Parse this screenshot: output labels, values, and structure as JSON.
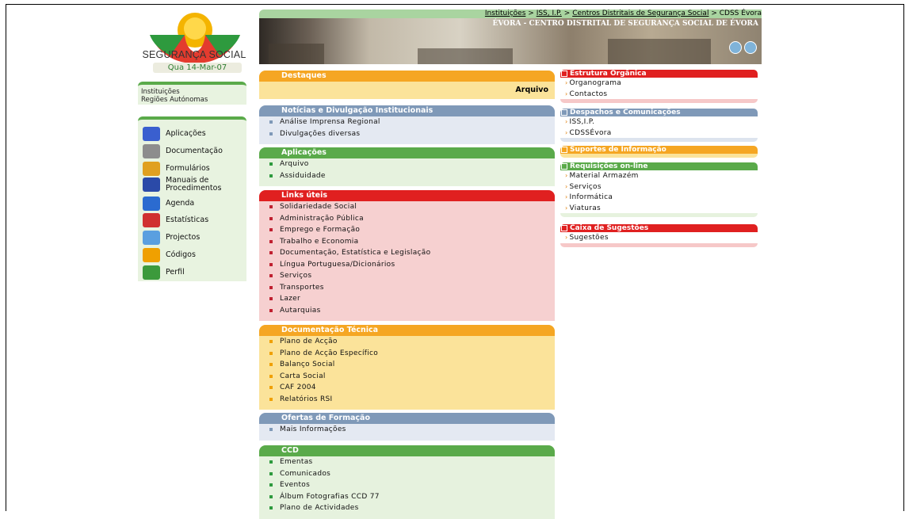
{
  "header": {
    "logo_text": "SEGURANÇA SOCIAL",
    "date": "Qua 14-Mar-07",
    "breadcrumb": [
      "Instituições",
      ">",
      "ISS, I.P.",
      ">",
      "Centros Distritais de Segurança Social",
      ">",
      "CDSS Évora"
    ],
    "banner_title": "ÉVORA - CENTRO DISTRITAL DE SEGURANÇA SOCIAL DE ÉVORA"
  },
  "sidebar": {
    "links": [
      "Instituições",
      "Regiões Autónomas"
    ],
    "apps": [
      {
        "label": "Aplicações",
        "icon": "applications-icon",
        "color": "#3a5fcf"
      },
      {
        "label": "Documentação",
        "icon": "documentation-icon",
        "color": "#8d8d8d"
      },
      {
        "label": "Formulários",
        "icon": "forms-icon",
        "color": "#e0a020"
      },
      {
        "label": "Manuais de\nProcedimentos",
        "icon": "manuals-icon",
        "color": "#2b4aa8"
      },
      {
        "label": "Agenda",
        "icon": "agenda-icon",
        "color": "#2b6bd0"
      },
      {
        "label": "Estatísticas",
        "icon": "statistics-icon",
        "color": "#d03030"
      },
      {
        "label": "Projectos",
        "icon": "projects-icon",
        "color": "#5a9fe0"
      },
      {
        "label": "Códigos",
        "icon": "codes-icon",
        "color": "#f0a000"
      },
      {
        "label": "Perfil",
        "icon": "profile-icon",
        "color": "#3c9a3c"
      }
    ]
  },
  "main": {
    "destaques": {
      "title": "Destaques",
      "link": "Arquivo"
    },
    "noticias": {
      "title": "Notícias e Divulgação Institucionais",
      "items": [
        "Análise Imprensa Regional",
        "Divulgações diversas"
      ]
    },
    "aplicacoes": {
      "title": "Aplicações",
      "items": [
        "Arquivo",
        "Assiduidade"
      ]
    },
    "links": {
      "title": "Links úteis",
      "items": [
        "Solidariedade Social",
        "Administração Pública",
        "Emprego e Formação",
        "Trabalho e Economia",
        "Documentação, Estatística e Legislação",
        "Língua Portuguesa/Dicionários",
        "Serviços",
        "Transportes",
        "Lazer",
        "Autarquias"
      ]
    },
    "doc_tecnica": {
      "title": "Documentação Técnica",
      "items": [
        "Plano de Acção",
        "Plano de Acção Específico",
        "Balanço Social",
        "Carta Social",
        "CAF 2004",
        "Relatórios RSI"
      ]
    },
    "formacao": {
      "title": "Ofertas de Formação",
      "items": [
        "Mais Informações"
      ]
    },
    "ccd": {
      "title": "CCD",
      "items": [
        "Ementas",
        "Comunicados",
        "Eventos",
        "Álbum Fotografias CCD 77",
        "Plano de Actividades"
      ]
    }
  },
  "right": {
    "estrutura": {
      "title": "Estrutura Orgânica",
      "items": [
        "Organograma",
        "Contactos"
      ]
    },
    "despachos": {
      "title": "Despachos e Comunicações",
      "items": [
        "ISS,I.P.",
        "CDSSÉvora"
      ]
    },
    "suportes": {
      "title": "Suportes de Informação",
      "items": []
    },
    "requisicoes": {
      "title": "Requisições on-line",
      "items": [
        "Material Armazém",
        "Serviços",
        "Informática",
        "Viaturas"
      ]
    },
    "sugestoes": {
      "title": "Caixa de Sugestões",
      "items": [
        "Sugestões"
      ]
    }
  },
  "colors": {
    "green": "#5aaa4a",
    "red": "#e02020",
    "orange": "#f5a623",
    "blue": "#7f99b8"
  }
}
